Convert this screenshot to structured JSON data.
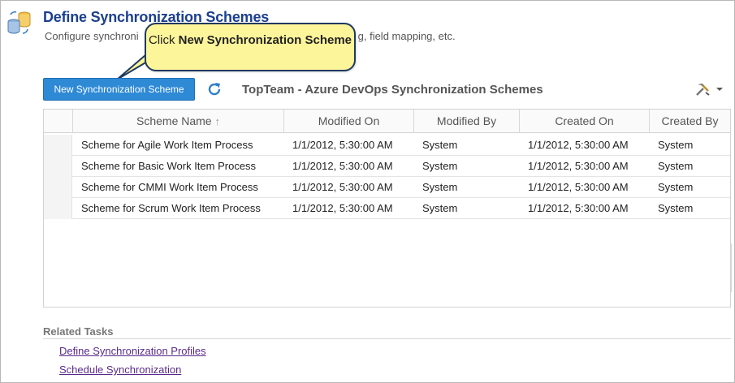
{
  "header": {
    "title": "Define Synchronization Schemes",
    "description_start": "Configure synchroni",
    "description_end": "g, field mapping, etc."
  },
  "callout": {
    "prefix": "Click ",
    "bold": "New Synchronization Scheme"
  },
  "toolbar": {
    "new_button_label": "New Synchronization Scheme",
    "refresh_icon": "refresh-icon",
    "grid_title": "TopTeam - Azure DevOps Synchronization Schemes",
    "tools_icon": "tools-icon"
  },
  "grid": {
    "columns": [
      {
        "label": "Scheme Name",
        "sort": "↑"
      },
      {
        "label": "Modified On"
      },
      {
        "label": "Modified By"
      },
      {
        "label": "Created On"
      },
      {
        "label": "Created By"
      }
    ],
    "rows": [
      {
        "name": "Scheme for Agile Work Item Process",
        "modified_on": "1/1/2012, 5:30:00 AM",
        "modified_by": "System",
        "created_on": "1/1/2012, 5:30:00 AM",
        "created_by": "System"
      },
      {
        "name": "Scheme for Basic Work Item Process",
        "modified_on": "1/1/2012, 5:30:00 AM",
        "modified_by": "System",
        "created_on": "1/1/2012, 5:30:00 AM",
        "created_by": "System"
      },
      {
        "name": "Scheme for CMMI Work Item Process",
        "modified_on": "1/1/2012, 5:30:00 AM",
        "modified_by": "System",
        "created_on": "1/1/2012, 5:30:00 AM",
        "created_by": "System"
      },
      {
        "name": "Scheme for Scrum Work Item Process",
        "modified_on": "1/1/2012, 5:30:00 AM",
        "modified_by": "System",
        "created_on": "1/1/2012, 5:30:00 AM",
        "created_by": "System"
      }
    ]
  },
  "related": {
    "title": "Related Tasks",
    "links": [
      "Define Synchronization Profiles",
      "Schedule Synchronization"
    ]
  },
  "colors": {
    "title": "#1b3f8f",
    "button": "#2f8ad6",
    "callout": "#fdf59a",
    "link": "#5a2a8a"
  }
}
